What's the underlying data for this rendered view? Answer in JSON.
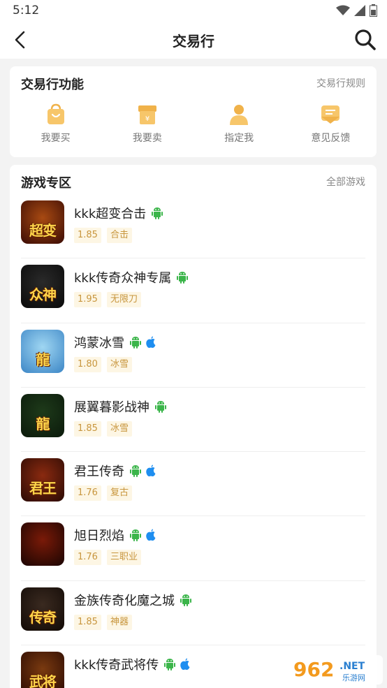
{
  "status": {
    "time": "5:12"
  },
  "nav": {
    "title": "交易行"
  },
  "functions": {
    "title": "交易行功能",
    "rules_link": "交易行规则",
    "items": [
      {
        "label": "我要买",
        "icon": "shopping-bag-icon"
      },
      {
        "label": "我要卖",
        "icon": "shop-icon"
      },
      {
        "label": "指定我",
        "icon": "person-icon"
      },
      {
        "label": "意见反馈",
        "icon": "feedback-icon"
      }
    ]
  },
  "games": {
    "title": "游戏专区",
    "all_link": "全部游戏",
    "list": [
      {
        "name": "kkk超变合击",
        "version": "1.85",
        "tag": "合击",
        "android": true,
        "ios": false,
        "thumb_text": "超变",
        "colors": [
          "#a84a12",
          "#3a0b04"
        ]
      },
      {
        "name": "kkk传奇众神专属",
        "version": "1.95",
        "tag": "无限刀",
        "android": true,
        "ios": false,
        "thumb_text": "众神",
        "colors": [
          "#2a2a2a",
          "#0a0a0a"
        ]
      },
      {
        "name": "鸿蒙冰雪",
        "version": "1.80",
        "tag": "冰雪",
        "android": true,
        "ios": true,
        "thumb_text": "龍",
        "colors": [
          "#9fd6f2",
          "#3c86c6"
        ]
      },
      {
        "name": "展翼暮影战神",
        "version": "1.85",
        "tag": "冰雪",
        "android": true,
        "ios": false,
        "thumb_text": "龍",
        "colors": [
          "#1e3a1a",
          "#0b1a0b"
        ]
      },
      {
        "name": "君王传奇",
        "version": "1.76",
        "tag": "复古",
        "android": true,
        "ios": true,
        "thumb_text": "君王",
        "colors": [
          "#8a2a10",
          "#2a0a04"
        ]
      },
      {
        "name": "旭日烈焰",
        "version": "1.76",
        "tag": "三职业",
        "android": true,
        "ios": true,
        "thumb_text": "",
        "colors": [
          "#7a1a08",
          "#1a0502"
        ]
      },
      {
        "name": "金族传奇化魔之城",
        "version": "1.85",
        "tag": "神器",
        "android": true,
        "ios": false,
        "thumb_text": "传奇",
        "colors": [
          "#3a2a20",
          "#120a06"
        ]
      },
      {
        "name": "kkk传奇武将传",
        "version": "",
        "tag": "",
        "android": true,
        "ios": true,
        "thumb_text": "武将",
        "colors": [
          "#7a3a10",
          "#2a0a02"
        ]
      }
    ]
  },
  "accent": "#f5a623"
}
